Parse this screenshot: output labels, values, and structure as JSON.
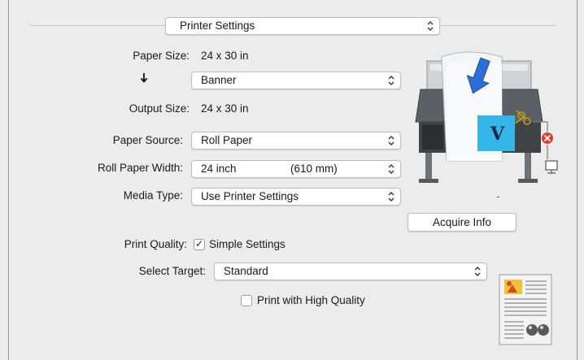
{
  "panel_popup": {
    "value": "Printer Settings"
  },
  "paper_size": {
    "label": "Paper Size:",
    "value": "24 x 30 in"
  },
  "layout_popup": {
    "value": "Banner"
  },
  "output_size": {
    "label": "Output Size:",
    "value": "24 x 30 in"
  },
  "paper_source": {
    "label": "Paper Source:",
    "value": "Roll Paper"
  },
  "roll_paper_width": {
    "label": "Roll Paper Width:",
    "value": "24 inch",
    "value_mm": "(610 mm)"
  },
  "media_type": {
    "label": "Media Type:",
    "value": "Use Printer Settings"
  },
  "acquire_info": {
    "label": "Acquire Info"
  },
  "print_quality": {
    "label": "Print Quality:",
    "checkbox_label": "Simple Settings",
    "checked": true
  },
  "select_target": {
    "label": "Select Target:",
    "value": "Standard"
  },
  "high_quality": {
    "label": "Print with High Quality",
    "checked": false
  },
  "printer_preview": {
    "media_letter": "V"
  },
  "colors": {
    "arrow_blue": "#2a6fd6",
    "media_cyan": "#35b6e8",
    "error_red": "#e23b2e"
  }
}
